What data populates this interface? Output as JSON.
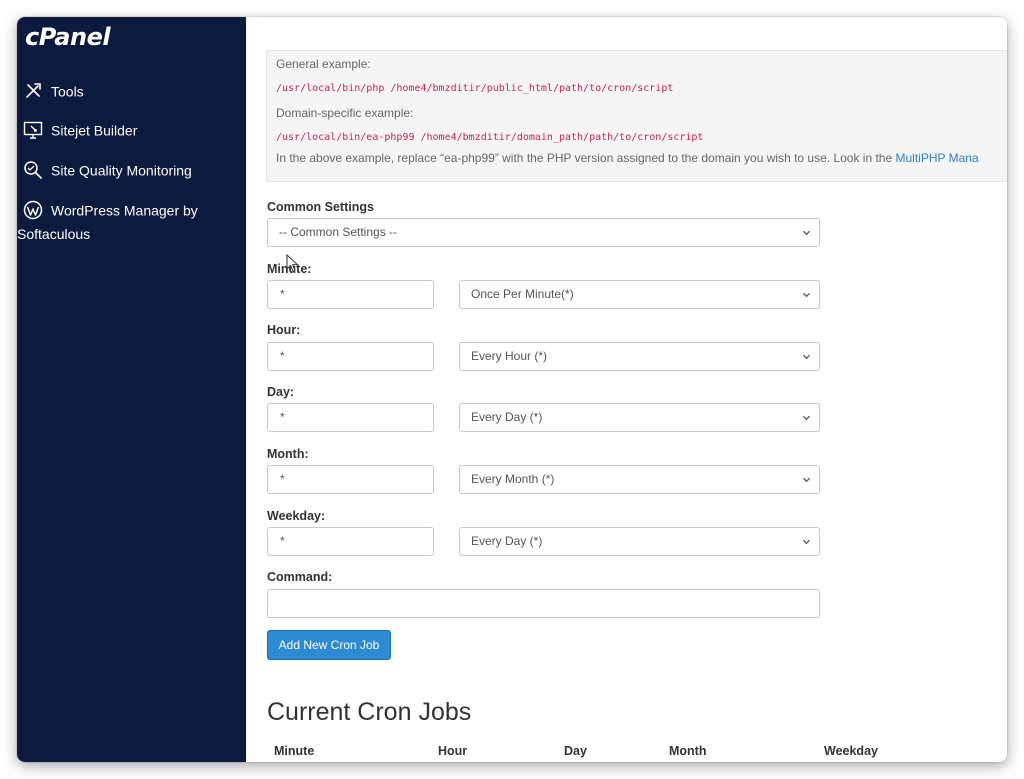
{
  "sidebar": {
    "logo": "cPanel",
    "items": [
      {
        "label": "Tools",
        "icon": "tools-icon"
      },
      {
        "label": "Sitejet Builder",
        "icon": "sitejet-icon"
      },
      {
        "label": "Site Quality Monitoring",
        "icon": "site-quality-icon"
      },
      {
        "label": "WordPress Manager by",
        "label2": "Softaculous",
        "icon": "wordpress-icon"
      }
    ]
  },
  "examples": {
    "general_label": "General example:",
    "general_code": "/usr/local/bin/php /home4/bmzditir/public_html/path/to/cron/script",
    "domain_label": "Domain-specific example:",
    "domain_code": "/usr/local/bin/ea-php99 /home4/bmzditir/domain_path/path/to/cron/script",
    "note": "In the above example, replace “ea-php99” with the PHP version assigned to the domain you wish to use. Look in the ",
    "note_link": "MultiPHP Mana"
  },
  "form": {
    "common_settings_label": "Common Settings",
    "common_settings_value": "-- Common Settings --",
    "minute_label": "Minute:",
    "minute_value": "*",
    "minute_select": "Once Per Minute(*)",
    "hour_label": "Hour:",
    "hour_value": "*",
    "hour_select": "Every Hour (*)",
    "day_label": "Day:",
    "day_value": "*",
    "day_select": "Every Day (*)",
    "month_label": "Month:",
    "month_value": "*",
    "month_select": "Every Month (*)",
    "weekday_label": "Weekday:",
    "weekday_value": "*",
    "weekday_select": "Every Day (*)",
    "command_label": "Command:",
    "command_value": "",
    "add_button": "Add New Cron Job"
  },
  "current": {
    "title": "Current Cron Jobs",
    "columns": [
      "Minute",
      "Hour",
      "Day",
      "Month",
      "Weekday"
    ]
  },
  "colors": {
    "sidebar_bg": "#0b1a3d",
    "accent": "#2d8bd4",
    "code": "#c7254e",
    "link": "#2f7ec8"
  }
}
